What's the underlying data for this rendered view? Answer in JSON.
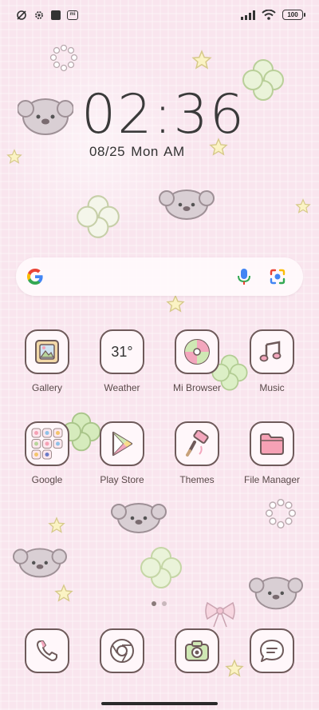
{
  "status_bar": {
    "battery": "100",
    "left_icons": [
      "no-alarm-icon",
      "settings-cog-icon",
      "square-notification-icon",
      "mi-icon"
    ],
    "right_icons": [
      "signal-icon",
      "wifi-icon",
      "battery-icon"
    ]
  },
  "clock": {
    "time": "02:36",
    "date": "08/25",
    "day": "Mon",
    "ampm": "AM"
  },
  "search": {
    "logo": "G",
    "icons": [
      "mic-icon",
      "google-lens-icon"
    ]
  },
  "apps": {
    "row1": [
      {
        "label": "Gallery",
        "icon": "gallery-icon"
      },
      {
        "label": "Weather",
        "icon": "weather-icon",
        "value": "31°"
      },
      {
        "label": "Mi Browser",
        "icon": "mi-browser-icon"
      },
      {
        "label": "Music",
        "icon": "music-icon"
      }
    ],
    "row2": [
      {
        "label": "Google",
        "icon": "google-folder-icon"
      },
      {
        "label": "Play Store",
        "icon": "play-store-icon"
      },
      {
        "label": "Themes",
        "icon": "themes-icon"
      },
      {
        "label": "File Manager",
        "icon": "file-manager-icon"
      }
    ],
    "dock": [
      {
        "icon": "phone-icon"
      },
      {
        "icon": "chrome-icon"
      },
      {
        "icon": "camera-icon"
      },
      {
        "icon": "messages-icon"
      }
    ]
  },
  "colors": {
    "background": "#f9e5ee",
    "tile_border": "#6e5a5a",
    "tile_fill": "#fff7fa",
    "accent_pink": "#f3a6bd",
    "accent_green": "#cfe8b4"
  }
}
